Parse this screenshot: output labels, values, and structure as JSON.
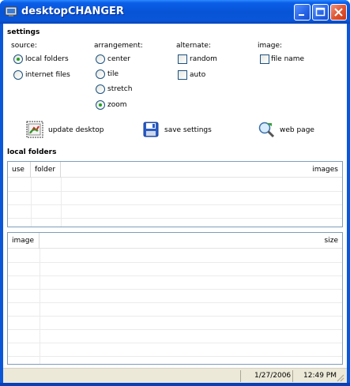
{
  "window": {
    "title": "desktopCHANGER"
  },
  "settings": {
    "heading": "settings",
    "source": {
      "label": "source:",
      "options": [
        "local folders",
        "internet files"
      ],
      "selected": "local folders"
    },
    "arrangement": {
      "label": "arrangement:",
      "options": [
        "center",
        "tile",
        "stretch",
        "zoom"
      ],
      "selected": "zoom"
    },
    "alternate": {
      "label": "alternate:",
      "options": [
        "random",
        "auto"
      ],
      "checked": []
    },
    "image": {
      "label": "image:",
      "options": [
        "file name"
      ],
      "checked": []
    }
  },
  "actions": {
    "update": "update desktop",
    "save": "save settings",
    "web": "web page"
  },
  "local_folders": {
    "heading": "local folders",
    "columns": {
      "use": "use",
      "folder": "folder",
      "images": "images"
    }
  },
  "images_list": {
    "columns": {
      "image": "image",
      "size": "size"
    }
  },
  "status": {
    "date": "1/27/2006",
    "time": "12:49 PM"
  }
}
